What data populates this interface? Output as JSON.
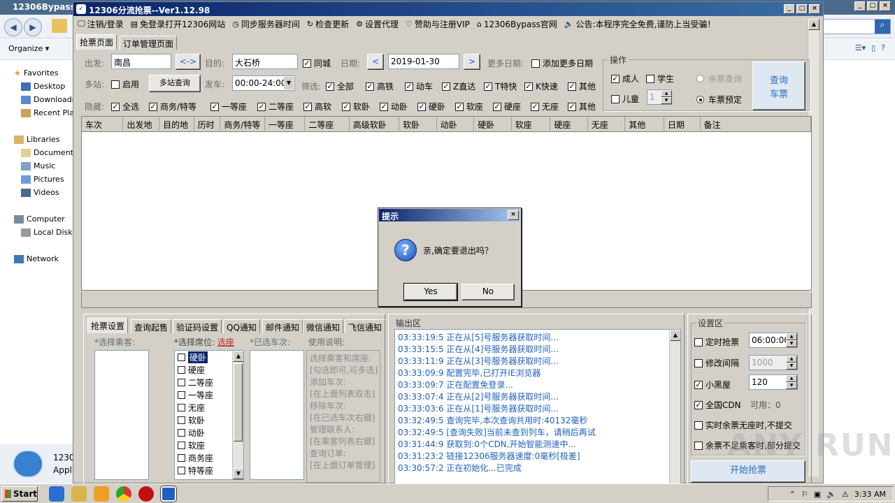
{
  "bg_window": {
    "title": "12306Bypass",
    "organize": "Organize",
    "sidebar": [
      {
        "label": "Favorites"
      },
      {
        "label": "Desktop"
      },
      {
        "label": "Downloads"
      },
      {
        "label": "Recent Pla"
      },
      {
        "label": "Libraries"
      },
      {
        "label": "Documents"
      },
      {
        "label": "Music"
      },
      {
        "label": "Pictures"
      },
      {
        "label": "Videos"
      },
      {
        "label": "Computer"
      },
      {
        "label": "Local Disk ("
      },
      {
        "label": "Network"
      }
    ],
    "status_lines": [
      "1230",
      "Appli"
    ]
  },
  "app": {
    "title": "12306分流抢票--Ver1.12.98",
    "menu": [
      {
        "icon": "monitor-icon",
        "label": "注销/登录"
      },
      {
        "icon": "doc-icon",
        "label": "免登录打开12306网站"
      },
      {
        "icon": "clock-icon",
        "label": "同步服务器时间"
      },
      {
        "icon": "refresh-icon",
        "label": "检查更新"
      },
      {
        "icon": "gear-icon",
        "label": "设置代理"
      },
      {
        "icon": "heart-icon",
        "label": "赞助与注册VIP"
      },
      {
        "icon": "home-icon",
        "label": "12306Bypass官网"
      },
      {
        "icon": "speaker-icon",
        "label": "公告:本程序完全免费,谨防上当受骗！"
      }
    ],
    "tabs": [
      "抢票页面",
      "订单管理页面"
    ],
    "query": {
      "from_label": "出发:",
      "from": "南昌",
      "swap": "<->",
      "to_label": "目的:",
      "to": "大石桥",
      "same_city": "同城",
      "date_label": "日期:",
      "date": "2019-01-30",
      "prev": "<",
      "next": ">",
      "more_dates_label": "更多日期:",
      "add_more_dates": "添加更多日期",
      "multi_label": "多站:",
      "enable": "启用",
      "multi_query": "多站查询",
      "depart_label": "发车:",
      "depart_time": "00:00-24:00",
      "filter_label": "筛选:",
      "filters": [
        "全部",
        "高铁",
        "动车",
        "Z直达",
        "T特快",
        "K快速",
        "其他"
      ],
      "hide_label": "隐藏:",
      "hides": [
        "全选",
        "商务/特等",
        "一等座",
        "二等座",
        "高软",
        "软卧",
        "动卧",
        "硬卧",
        "软座",
        "硬座",
        "无座",
        "其他"
      ]
    },
    "ops": {
      "title": "操作",
      "adult": "成人",
      "student": "学生",
      "child": "儿童",
      "child_count": "1",
      "remain_query": "余票查询",
      "ticket_book": "车票预定",
      "query_btn_1": "查询",
      "query_btn_2": "车票"
    },
    "grid_columns": [
      "车次",
      "出发地",
      "目的地",
      "历时",
      "商务/特等",
      "一等座",
      "二等座",
      "高级软卧",
      "软卧",
      "动卧",
      "硬卧",
      "软座",
      "硬座",
      "无座",
      "其他",
      "日期",
      "备注"
    ],
    "bottom_tabs": [
      "抢票设置",
      "查询起售",
      "验证码设置",
      "QQ通知",
      "邮件通知",
      "微信通知",
      "飞信通知"
    ],
    "passengers_label": "*选择乘客:",
    "seats_label": "*选择席位:",
    "seats_link": "选座",
    "selected_trains_label": "*已选车次:",
    "usage_label": "使用说明:",
    "seats": [
      {
        "name": "硬卧",
        "sel": true
      },
      {
        "name": "硬座"
      },
      {
        "name": "二等座"
      },
      {
        "name": "一等座"
      },
      {
        "name": "无座"
      },
      {
        "name": "软卧"
      },
      {
        "name": "动卧"
      },
      {
        "name": "软座"
      },
      {
        "name": "商务座"
      },
      {
        "name": "特等座"
      }
    ],
    "usage": [
      "选择乘客和席座:",
      "[勾选即可,可多选]",
      "添加车次:",
      "[在上面列表双击]",
      "移除车次:",
      "[在已选车次右键]",
      "管理联系人:",
      "[在乘客列表右键]",
      "查询订单:",
      "[在上面订单管理]"
    ],
    "output_label": "输出区",
    "log": [
      "03:33:19:5  正在从[5]号服务器获取时间...",
      "03:33:15:5  正在从[4]号服务器获取时间...",
      "03:33:11:9  正在从[3]号服务器获取时间...",
      "03:33:09:9  配置完毕,已打开IE浏览器",
      "03:33:09:7  正在配置免登录...",
      "03:33:07:4  正在从[2]号服务器获取时间...",
      "03:33:03:6  正在从[1]号服务器获取时间...",
      "03:32:49:5  查询完毕,本次查询共用时:40132毫秒",
      "03:32:49:5  [查询失败]当前未查到列车，请稍后再试",
      "03:31:44:9  获取到:0个CDN,开始智能测速中...",
      "03:31:23:2  链接12306服务器速度:0毫秒[极差]",
      "03:30:57:2  正在初始化...已完成"
    ],
    "settings": {
      "title": "设置区",
      "timed": "定时抢票",
      "timed_value": "06:00:00",
      "interval": "修改间隔",
      "interval_value": "1000",
      "blackroom": "小黑屋",
      "blackroom_value": "120",
      "cdn": "全国CDN",
      "cdn_avail": "可用：0",
      "realtime": "实时余票无座时,不提交",
      "partial": "余票不足乘客时,部分提交",
      "start": "开始抢票"
    }
  },
  "dialog": {
    "title": "提示",
    "message": "亲,确定要退出吗？",
    "yes": "Yes",
    "no": "No"
  },
  "taskbar": {
    "start": "Start",
    "time": "3:33 AM"
  },
  "watermark": "ANY RUN"
}
